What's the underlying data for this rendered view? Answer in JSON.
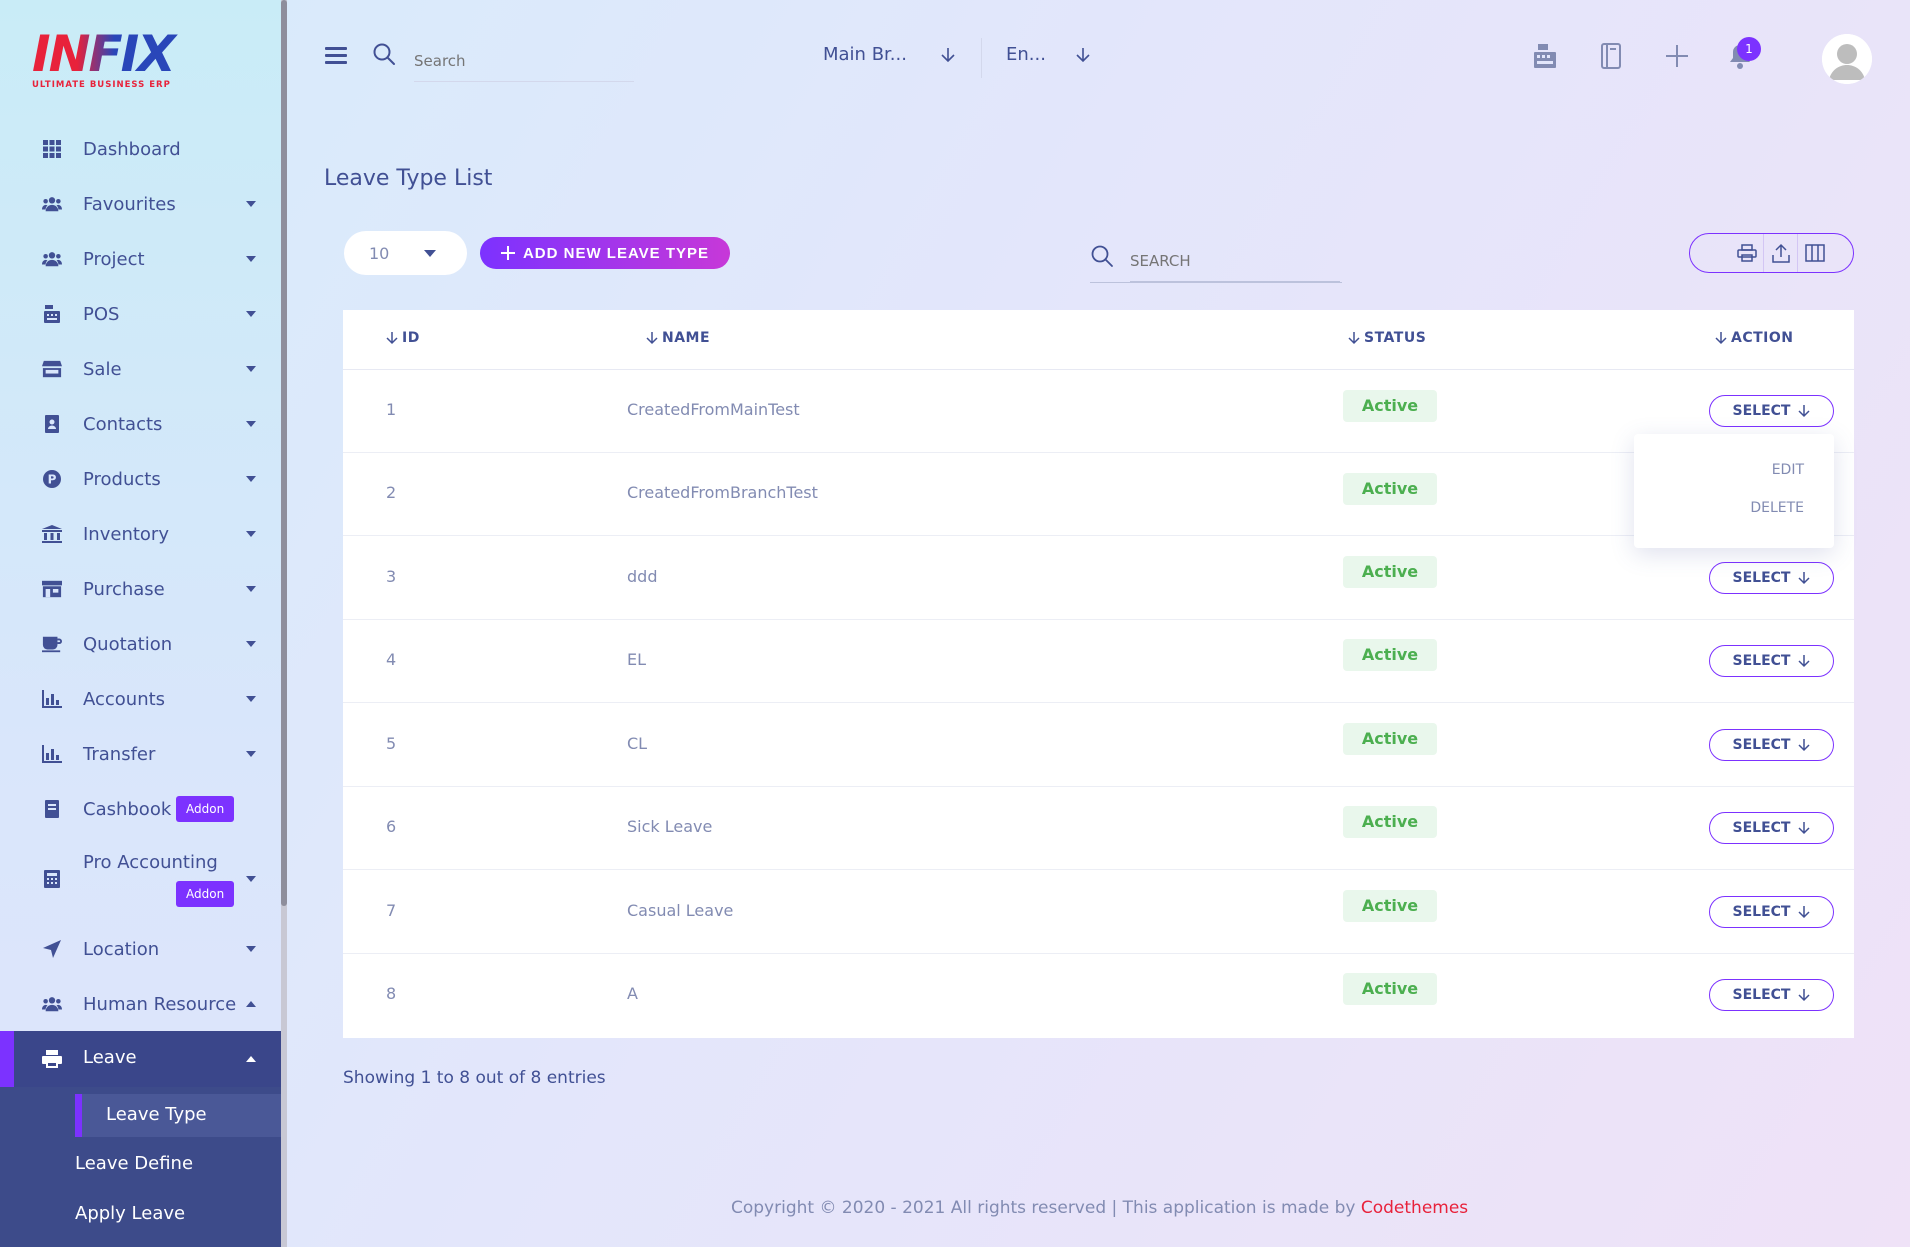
{
  "brand": {
    "logo_text": "INFIX",
    "logo_sub": "ULTIMATE BUSINESS ERP"
  },
  "sidebar": {
    "items": [
      {
        "label": "Dashboard",
        "icon": "grid-icon"
      },
      {
        "label": "Favourites",
        "icon": "users-icon"
      },
      {
        "label": "Project",
        "icon": "users-icon"
      },
      {
        "label": "POS",
        "icon": "cash-register-icon"
      },
      {
        "label": "Sale",
        "icon": "store-icon"
      },
      {
        "label": "Contacts",
        "icon": "contact-book-icon"
      },
      {
        "label": "Products",
        "icon": "product-p-icon"
      },
      {
        "label": "Inventory",
        "icon": "bank-icon"
      },
      {
        "label": "Purchase",
        "icon": "shop-icon"
      },
      {
        "label": "Quotation",
        "icon": "coffee-icon"
      },
      {
        "label": "Accounts",
        "icon": "bar-chart-icon"
      },
      {
        "label": "Transfer",
        "icon": "bar-chart-icon"
      },
      {
        "label": "Cashbook",
        "icon": "book-icon",
        "badge": "Addon"
      },
      {
        "label": "Pro Accounting",
        "icon": "calculator-icon",
        "badge": "Addon"
      },
      {
        "label": "Location",
        "icon": "location-arrow-icon"
      },
      {
        "label": "Human Resource",
        "icon": "users-icon"
      },
      {
        "label": "Leave",
        "icon": "print-icon"
      }
    ],
    "leave_sub": [
      "Leave Type",
      "Leave Define",
      "Apply Leave"
    ]
  },
  "topbar": {
    "search_placeholder": "Search",
    "branch_select": "Main Br...",
    "language_select": "En...",
    "notification_count": "1"
  },
  "page": {
    "title": "Leave Type List",
    "per_page": "10",
    "add_button": "ADD NEW LEAVE TYPE",
    "search_placeholder": "SEARCH"
  },
  "table": {
    "columns": [
      "ID",
      "NAME",
      "STATUS",
      "ACTION"
    ],
    "rows": [
      {
        "id": "1",
        "name": "CreatedFromMainTest",
        "status": "Active"
      },
      {
        "id": "2",
        "name": "CreatedFromBranchTest",
        "status": "Active"
      },
      {
        "id": "3",
        "name": "ddd",
        "status": "Active"
      },
      {
        "id": "4",
        "name": "EL",
        "status": "Active"
      },
      {
        "id": "5",
        "name": "CL",
        "status": "Active"
      },
      {
        "id": "6",
        "name": "Sick Leave",
        "status": "Active"
      },
      {
        "id": "7",
        "name": "Casual Leave",
        "status": "Active"
      },
      {
        "id": "8",
        "name": "A",
        "status": "Active"
      }
    ],
    "select_label": "SELECT",
    "dropdown": {
      "edit": "EDIT",
      "delete": "DELETE"
    }
  },
  "showing_text": "Showing 1 to 8 out of 8 entries",
  "footer": {
    "text": "Copyright © 2020 - 2021 All rights reserved | This application is made by ",
    "brand": "Codethemes"
  },
  "colors": {
    "accent": "#7c32ff",
    "text": "#415094",
    "muted": "#828bb2",
    "active_green": "#4caf50",
    "brand_red": "#e8223b"
  }
}
